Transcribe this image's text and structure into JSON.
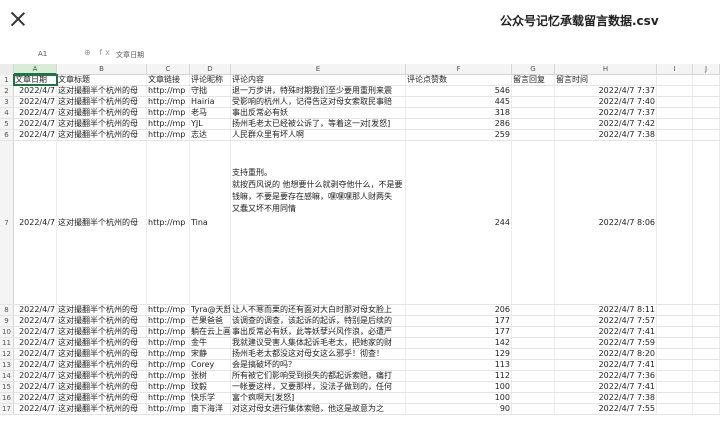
{
  "titlebar": {
    "close_icon": "close-icon",
    "file_title": "公众号记忆承载留言数据.csv"
  },
  "formulabar": {
    "name_box": "A1",
    "icons": "⊕ fx",
    "content": "文章日期"
  },
  "columns": [
    "A",
    "B",
    "C",
    "D",
    "E",
    "F",
    "G",
    "H",
    "I",
    "J"
  ],
  "header_row": {
    "num": "1",
    "cells": [
      "文章日期",
      "文章标题",
      "文章链接",
      "评论昵称",
      "评论内容",
      "评论点赞数",
      "留言回复",
      "留言时间",
      "",
      ""
    ]
  },
  "rows": [
    {
      "num": "2",
      "date": "2022/4/7",
      "title": "这对撮翻半个杭州的母",
      "link": "http://mp",
      "nick": "守拙",
      "content": "退一万步讲，特殊时期我们至少要用重刑来震",
      "likes": "546",
      "reply": "",
      "time": "2022/4/7 7:37"
    },
    {
      "num": "3",
      "date": "2022/4/7",
      "title": "这对撮翻半个杭州的母",
      "link": "http://mp",
      "nick": "Hairia",
      "content": "受影响的杭州人，记得告这对母女索取民事赔",
      "likes": "445",
      "reply": "",
      "time": "2022/4/7 7:40"
    },
    {
      "num": "4",
      "date": "2022/4/7",
      "title": "这对撮翻半个杭州的母",
      "link": "http://mp",
      "nick": "老马",
      "content": "事出反常必有妖",
      "likes": "318",
      "reply": "",
      "time": "2022/4/7 7:37"
    },
    {
      "num": "5",
      "date": "2022/4/7",
      "title": "这对撮翻半个杭州的母",
      "link": "http://mp",
      "nick": "YJL",
      "content": "扬州毛老太已经被公诉了，等着这一对[发怒]",
      "likes": "286",
      "reply": "",
      "time": "2022/4/7 7:42"
    },
    {
      "num": "6",
      "date": "2022/4/7",
      "title": "这对撮翻半个杭州的母",
      "link": "http://mp",
      "nick": "志达",
      "content": "人民群众里有坏人啊",
      "likes": "259",
      "reply": "",
      "time": "2022/4/7 7:38"
    },
    {
      "num": "7",
      "date": "2022/4/7",
      "title": "这对撮翻半个杭州的母",
      "link": "http://mp",
      "nick": "Tina",
      "content": "支持重刑。\n就按西风说的 他想要什么就剥夺他什么，不是要钱嘛，不要是要存在感嘛，嘿嘿嘿那人财两失\n又蠢又坏不用同情",
      "likes": "244",
      "reply": "",
      "time": "2022/4/7 8:06"
    },
    {
      "num": "8",
      "date": "2022/4/7",
      "title": "这对撮翻半个杭州的母",
      "link": "http://mp",
      "nick": "Tyra@天舒",
      "content": "让人不寒而栗的还有面对大白时那对母女脸上",
      "likes": "206",
      "reply": "",
      "time": "2022/4/7 8:11"
    },
    {
      "num": "9",
      "date": "2022/4/7",
      "title": "这对撮翻半个杭州的母",
      "link": "http://mp",
      "nick": "芒果爸爸",
      "content": "该调查的调查，该起诉的起诉，特别是后续的",
      "likes": "177",
      "reply": "",
      "time": "2022/4/7 7:57"
    },
    {
      "num": "10",
      "date": "2022/4/7",
      "title": "这对撮翻半个杭州的母",
      "link": "http://mp",
      "nick": "躺在云上画",
      "content": "事出反常必有妖，此等妖孽兴风作浪，必遭严",
      "likes": "177",
      "reply": "",
      "time": "2022/4/7 7:41"
    },
    {
      "num": "11",
      "date": "2022/4/7",
      "title": "这对撮翻半个杭州的母",
      "link": "http://mp",
      "nick": "金牛",
      "content": "我就建议受害人集体起诉毛老太，把她家的财",
      "likes": "142",
      "reply": "",
      "time": "2022/4/7 7:59"
    },
    {
      "num": "12",
      "date": "2022/4/7",
      "title": "这对撮翻半个杭州的母",
      "link": "http://mp",
      "nick": "宋静",
      "content": "扬州毛老太都没这对母女这么邪乎！彻查！",
      "likes": "129",
      "reply": "",
      "time": "2022/4/7 8:20"
    },
    {
      "num": "13",
      "date": "2022/4/7",
      "title": "这对撮翻半个杭州的母",
      "link": "http://mp",
      "nick": "Corey",
      "content": "会是搞破坏的吗？",
      "likes": "113",
      "reply": "",
      "time": "2022/4/7 7:41"
    },
    {
      "num": "14",
      "date": "2022/4/7",
      "title": "这对撮翻半个杭州的母",
      "link": "http://mp",
      "nick": "张树",
      "content": "所有被它们影响受到损失的都起诉索赔，痛打",
      "likes": "112",
      "reply": "",
      "time": "2022/4/7 7:36"
    },
    {
      "num": "15",
      "date": "2022/4/7",
      "title": "这对撮翻半个杭州的母",
      "link": "http://mp",
      "nick": "玟毅",
      "content": "一帐要这样，又要那样，没法子做到的，任何",
      "likes": "100",
      "reply": "",
      "time": "2022/4/7 7:41"
    },
    {
      "num": "16",
      "date": "2022/4/7",
      "title": "这对撮翻半个杭州的母",
      "link": "http://mp",
      "nick": "快乐学",
      "content": "富个疯啊天[发怒]",
      "likes": "100",
      "reply": "",
      "time": "2022/4/7 7:38"
    },
    {
      "num": "17",
      "date": "2022/4/7",
      "title": "这对撮翻半个杭州的母",
      "link": "http://mp",
      "nick": "南下海洋",
      "content": "对这对母女进行集体索赔，他这是故意为之",
      "likes": "90",
      "reply": "",
      "time": "2022/4/7 7:55"
    }
  ]
}
